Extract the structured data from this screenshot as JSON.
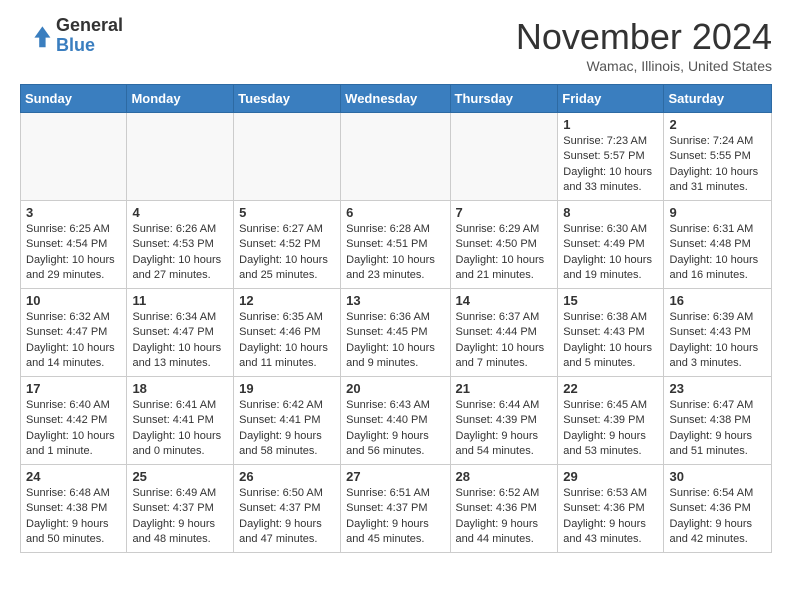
{
  "header": {
    "logo_general": "General",
    "logo_blue": "Blue",
    "month_title": "November 2024",
    "location": "Wamac, Illinois, United States"
  },
  "days_of_week": [
    "Sunday",
    "Monday",
    "Tuesday",
    "Wednesday",
    "Thursday",
    "Friday",
    "Saturday"
  ],
  "weeks": [
    [
      {
        "day": "",
        "info": ""
      },
      {
        "day": "",
        "info": ""
      },
      {
        "day": "",
        "info": ""
      },
      {
        "day": "",
        "info": ""
      },
      {
        "day": "",
        "info": ""
      },
      {
        "day": "1",
        "info": "Sunrise: 7:23 AM\nSunset: 5:57 PM\nDaylight: 10 hours\nand 33 minutes."
      },
      {
        "day": "2",
        "info": "Sunrise: 7:24 AM\nSunset: 5:55 PM\nDaylight: 10 hours\nand 31 minutes."
      }
    ],
    [
      {
        "day": "3",
        "info": "Sunrise: 6:25 AM\nSunset: 4:54 PM\nDaylight: 10 hours\nand 29 minutes."
      },
      {
        "day": "4",
        "info": "Sunrise: 6:26 AM\nSunset: 4:53 PM\nDaylight: 10 hours\nand 27 minutes."
      },
      {
        "day": "5",
        "info": "Sunrise: 6:27 AM\nSunset: 4:52 PM\nDaylight: 10 hours\nand 25 minutes."
      },
      {
        "day": "6",
        "info": "Sunrise: 6:28 AM\nSunset: 4:51 PM\nDaylight: 10 hours\nand 23 minutes."
      },
      {
        "day": "7",
        "info": "Sunrise: 6:29 AM\nSunset: 4:50 PM\nDaylight: 10 hours\nand 21 minutes."
      },
      {
        "day": "8",
        "info": "Sunrise: 6:30 AM\nSunset: 4:49 PM\nDaylight: 10 hours\nand 19 minutes."
      },
      {
        "day": "9",
        "info": "Sunrise: 6:31 AM\nSunset: 4:48 PM\nDaylight: 10 hours\nand 16 minutes."
      }
    ],
    [
      {
        "day": "10",
        "info": "Sunrise: 6:32 AM\nSunset: 4:47 PM\nDaylight: 10 hours\nand 14 minutes."
      },
      {
        "day": "11",
        "info": "Sunrise: 6:34 AM\nSunset: 4:47 PM\nDaylight: 10 hours\nand 13 minutes."
      },
      {
        "day": "12",
        "info": "Sunrise: 6:35 AM\nSunset: 4:46 PM\nDaylight: 10 hours\nand 11 minutes."
      },
      {
        "day": "13",
        "info": "Sunrise: 6:36 AM\nSunset: 4:45 PM\nDaylight: 10 hours\nand 9 minutes."
      },
      {
        "day": "14",
        "info": "Sunrise: 6:37 AM\nSunset: 4:44 PM\nDaylight: 10 hours\nand 7 minutes."
      },
      {
        "day": "15",
        "info": "Sunrise: 6:38 AM\nSunset: 4:43 PM\nDaylight: 10 hours\nand 5 minutes."
      },
      {
        "day": "16",
        "info": "Sunrise: 6:39 AM\nSunset: 4:43 PM\nDaylight: 10 hours\nand 3 minutes."
      }
    ],
    [
      {
        "day": "17",
        "info": "Sunrise: 6:40 AM\nSunset: 4:42 PM\nDaylight: 10 hours\nand 1 minute."
      },
      {
        "day": "18",
        "info": "Sunrise: 6:41 AM\nSunset: 4:41 PM\nDaylight: 10 hours\nand 0 minutes."
      },
      {
        "day": "19",
        "info": "Sunrise: 6:42 AM\nSunset: 4:41 PM\nDaylight: 9 hours\nand 58 minutes."
      },
      {
        "day": "20",
        "info": "Sunrise: 6:43 AM\nSunset: 4:40 PM\nDaylight: 9 hours\nand 56 minutes."
      },
      {
        "day": "21",
        "info": "Sunrise: 6:44 AM\nSunset: 4:39 PM\nDaylight: 9 hours\nand 54 minutes."
      },
      {
        "day": "22",
        "info": "Sunrise: 6:45 AM\nSunset: 4:39 PM\nDaylight: 9 hours\nand 53 minutes."
      },
      {
        "day": "23",
        "info": "Sunrise: 6:47 AM\nSunset: 4:38 PM\nDaylight: 9 hours\nand 51 minutes."
      }
    ],
    [
      {
        "day": "24",
        "info": "Sunrise: 6:48 AM\nSunset: 4:38 PM\nDaylight: 9 hours\nand 50 minutes."
      },
      {
        "day": "25",
        "info": "Sunrise: 6:49 AM\nSunset: 4:37 PM\nDaylight: 9 hours\nand 48 minutes."
      },
      {
        "day": "26",
        "info": "Sunrise: 6:50 AM\nSunset: 4:37 PM\nDaylight: 9 hours\nand 47 minutes."
      },
      {
        "day": "27",
        "info": "Sunrise: 6:51 AM\nSunset: 4:37 PM\nDaylight: 9 hours\nand 45 minutes."
      },
      {
        "day": "28",
        "info": "Sunrise: 6:52 AM\nSunset: 4:36 PM\nDaylight: 9 hours\nand 44 minutes."
      },
      {
        "day": "29",
        "info": "Sunrise: 6:53 AM\nSunset: 4:36 PM\nDaylight: 9 hours\nand 43 minutes."
      },
      {
        "day": "30",
        "info": "Sunrise: 6:54 AM\nSunset: 4:36 PM\nDaylight: 9 hours\nand 42 minutes."
      }
    ]
  ]
}
